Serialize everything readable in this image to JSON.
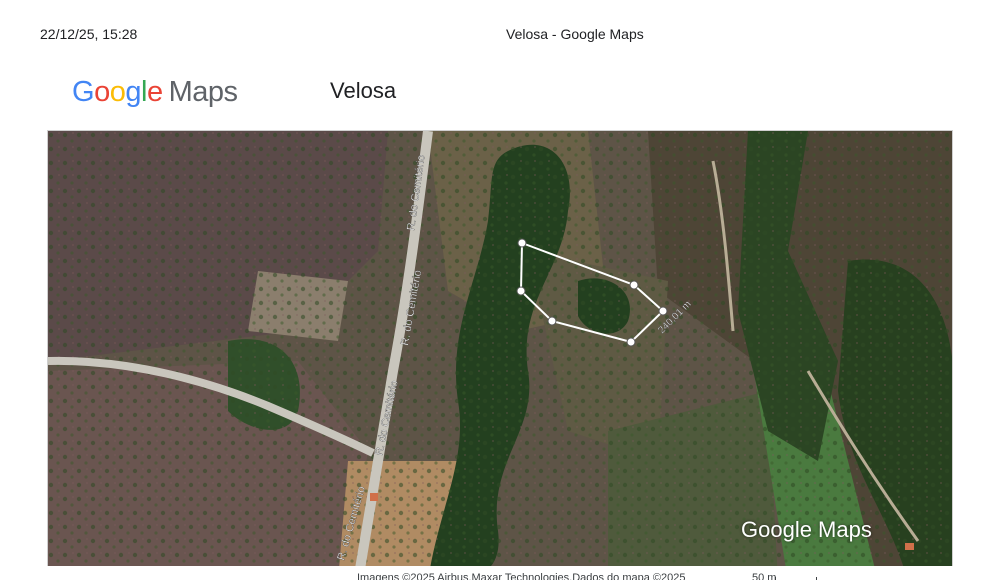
{
  "print_header": {
    "date": "22/12/25, 15:28",
    "title": "Velosa - Google Maps"
  },
  "brand": {
    "logo_parts": [
      "G",
      "o",
      "o",
      "g",
      "l",
      "e"
    ],
    "logo_suffix": "Maps",
    "colors": {
      "blue": "#4285f4",
      "red": "#ea4335",
      "yellow": "#fbbc05",
      "green": "#34a853",
      "grey": "#5f6368"
    }
  },
  "place": {
    "title": "Velosa"
  },
  "map": {
    "view": "satellite",
    "roads": [
      {
        "label": "R. do Cemitério"
      },
      {
        "label": "R. do Cemitério"
      },
      {
        "label": "R. do Cemitério"
      },
      {
        "label": "R. do Cemitério"
      }
    ],
    "measurement": {
      "distance_label": "240,01 m",
      "line_color": "#ffffff"
    },
    "watermark": "Google Maps"
  },
  "footer": {
    "attribution": "Imagens ©2025 Airbus,Maxar Technologies,Dados do mapa ©2025",
    "scale_label": "50 m"
  }
}
